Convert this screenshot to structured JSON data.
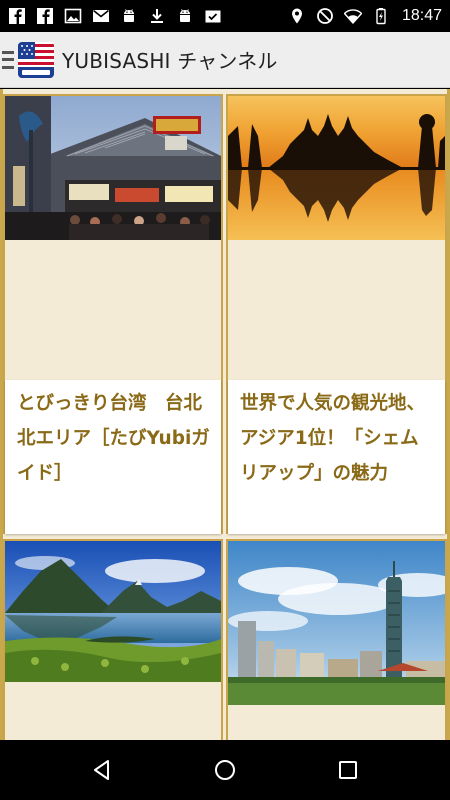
{
  "status_bar": {
    "time": "18:47",
    "icons_left": [
      "facebook-icon",
      "facebook-icon",
      "image-icon",
      "gmail-icon",
      "android-icon",
      "download-icon",
      "android-icon",
      "photo-check-icon"
    ],
    "icons_right": [
      "location-icon",
      "do-not-disturb-icon",
      "wifi-icon",
      "battery-charging-icon"
    ]
  },
  "app_bar": {
    "title": "YUBISASHI チャンネル",
    "logo": "us-flag-yubisashi-logo"
  },
  "cards": [
    {
      "title": "とびっきり台湾　台北 北エリア［たびYubiガイド］",
      "image": "taipei-night-market-photo"
    },
    {
      "title": "世界で人気の観光地、アジア1位！「シェムリアップ」の魅力",
      "image": "angkor-wat-sunset-photo"
    },
    {
      "title": "",
      "image": "new-zealand-fjord-photo"
    },
    {
      "title": "",
      "image": "taipei-101-skyline-photo"
    }
  ],
  "nav_bar": {
    "buttons": [
      "back-button",
      "home-button",
      "recents-button"
    ]
  },
  "colors": {
    "accent_gold": "#c9a44a",
    "caption_text": "#8a6a17",
    "card_background": "#f4ebd6",
    "app_bar": "#eeeeee"
  }
}
